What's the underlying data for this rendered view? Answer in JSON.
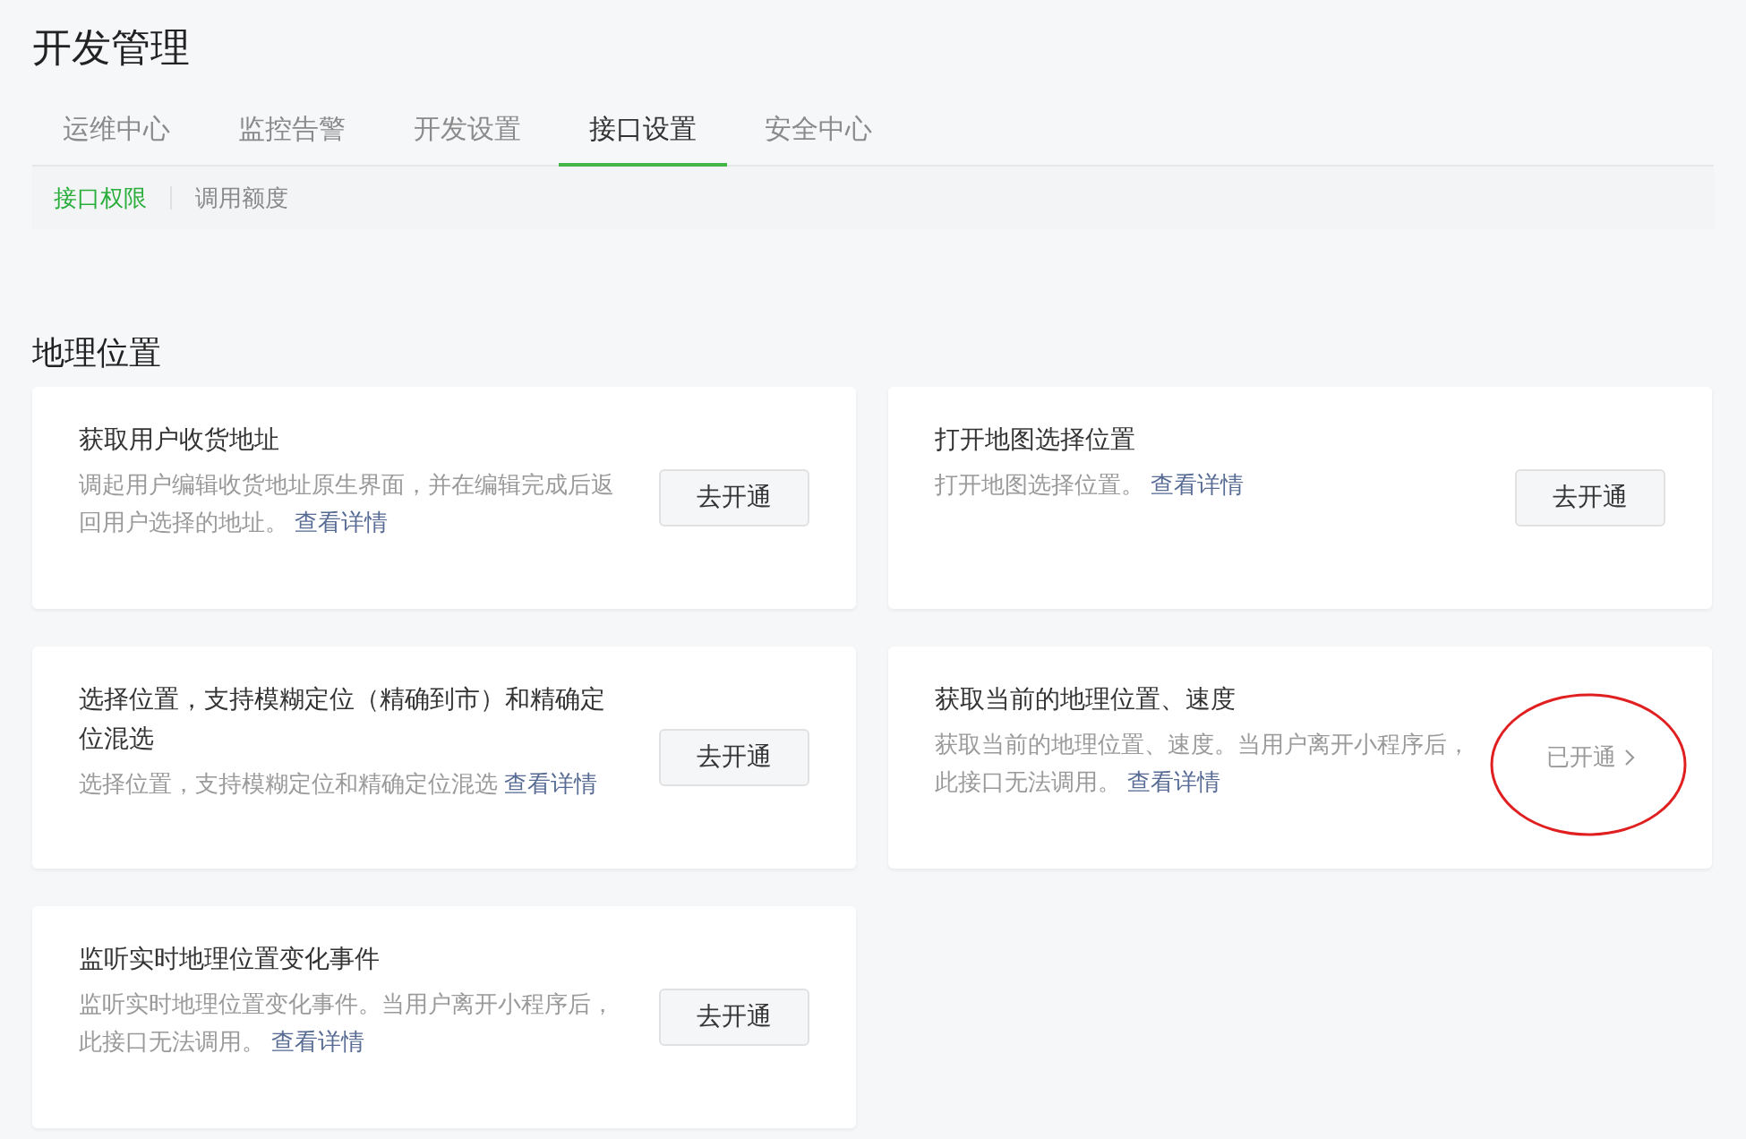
{
  "page_title": "开发管理",
  "tabs": [
    {
      "label": "运维中心",
      "selected": false
    },
    {
      "label": "监控告警",
      "selected": false
    },
    {
      "label": "开发设置",
      "selected": false
    },
    {
      "label": "接口设置",
      "selected": true
    },
    {
      "label": "安全中心",
      "selected": false
    }
  ],
  "subtabs": [
    {
      "label": "接口权限",
      "selected": true
    },
    {
      "label": "调用额度",
      "selected": false
    }
  ],
  "section_title": "地理位置",
  "cards": [
    {
      "title": "获取用户收货地址",
      "description": "调起用户编辑收货地址原生界面，并在编辑完成后返回用户选择的地址。",
      "link": "查看详情",
      "kind": "button",
      "action": "去开通",
      "highlighted": false
    },
    {
      "title": "打开地图选择位置",
      "description": "打开地图选择位置。",
      "link": "查看详情",
      "kind": "button",
      "action": "去开通",
      "highlighted": false
    },
    {
      "title": "选择位置，支持模糊定位（精确到市）和精确定位混选",
      "description": "选择位置，支持模糊定位和精确定位混选",
      "link": "查看详情",
      "kind": "button",
      "action": "去开通",
      "highlighted": false
    },
    {
      "title": "获取当前的地理位置、速度",
      "description": "获取当前的地理位置、速度。当用户离开小程序后，此接口无法调用。",
      "link": "查看详情",
      "kind": "status",
      "action": "已开通",
      "highlighted": true
    },
    {
      "title": "监听实时地理位置变化事件",
      "description": "监听实时地理位置变化事件。当用户离开小程序后，此接口无法调用。",
      "link": "查看详情",
      "kind": "button",
      "action": "去开通",
      "highlighted": false
    }
  ]
}
